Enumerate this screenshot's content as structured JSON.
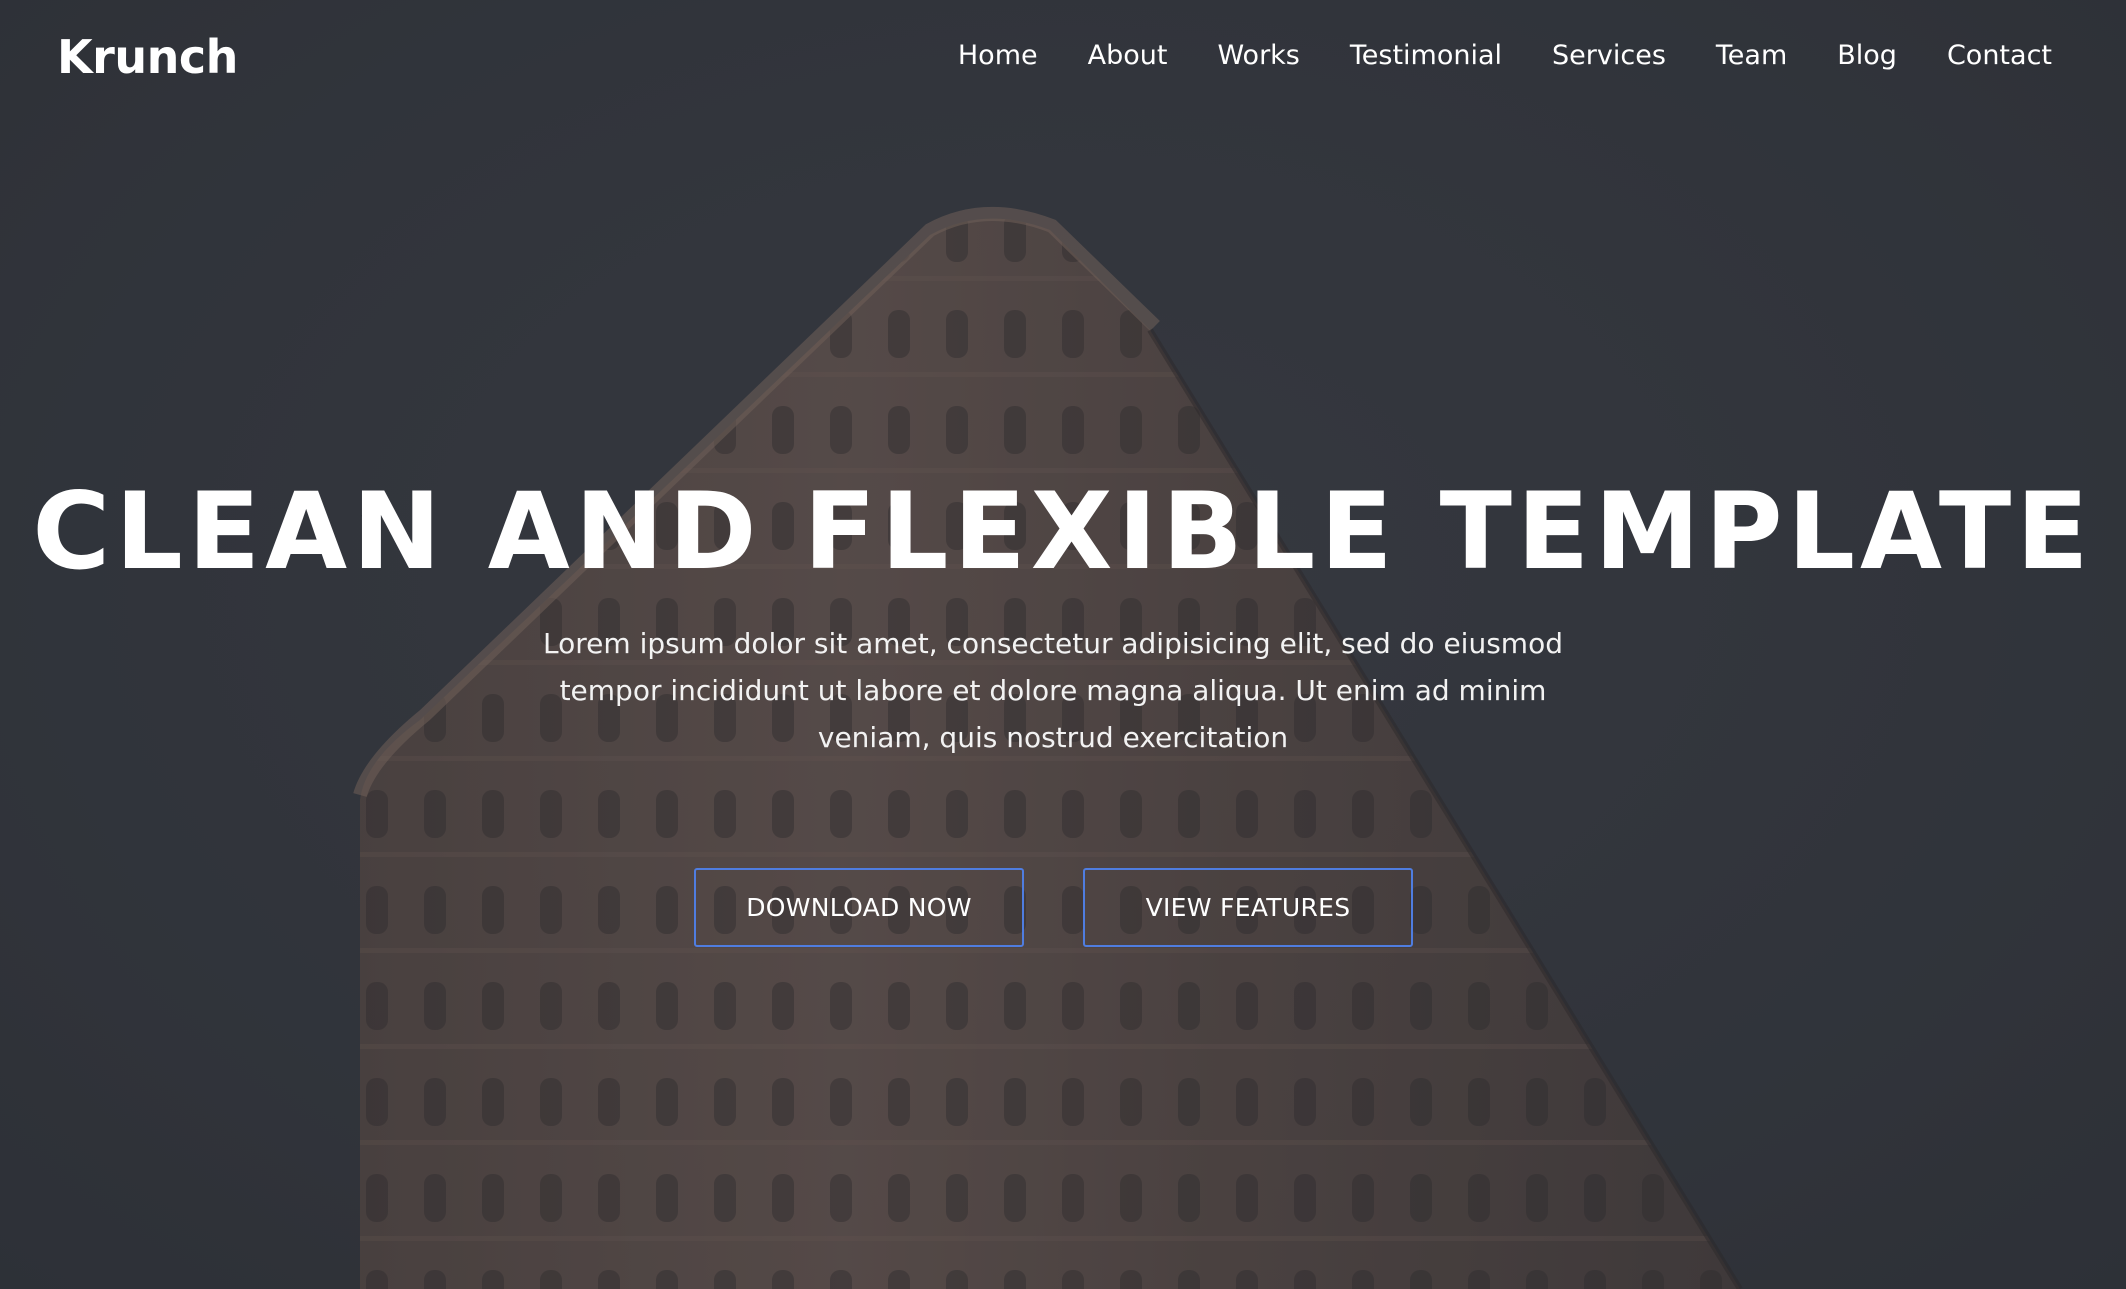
{
  "brand": {
    "logo_text": "Krunch"
  },
  "nav": {
    "items": [
      {
        "label": "Home"
      },
      {
        "label": "About"
      },
      {
        "label": "Works"
      },
      {
        "label": "Testimonial"
      },
      {
        "label": "Services"
      },
      {
        "label": "Team"
      },
      {
        "label": "Blog"
      },
      {
        "label": "Contact"
      }
    ]
  },
  "hero": {
    "headline": "CLEAN AND FLEXIBLE TEMPLATE",
    "lead": "Lorem ipsum dolor sit amet, consectetur adipisicing elit, sed do eiusmod tempor incididunt ut labore et dolore magna aliqua. Ut enim ad minim veniam, quis nostrud exercitation",
    "buttons": {
      "download_label": "DOWNLOAD NOW",
      "features_label": "VIEW FEATURES"
    },
    "background_image": "flatiron-building-photo"
  },
  "colors": {
    "background": "#35383f",
    "button_border": "#4f7de0",
    "text": "#ffffff"
  }
}
